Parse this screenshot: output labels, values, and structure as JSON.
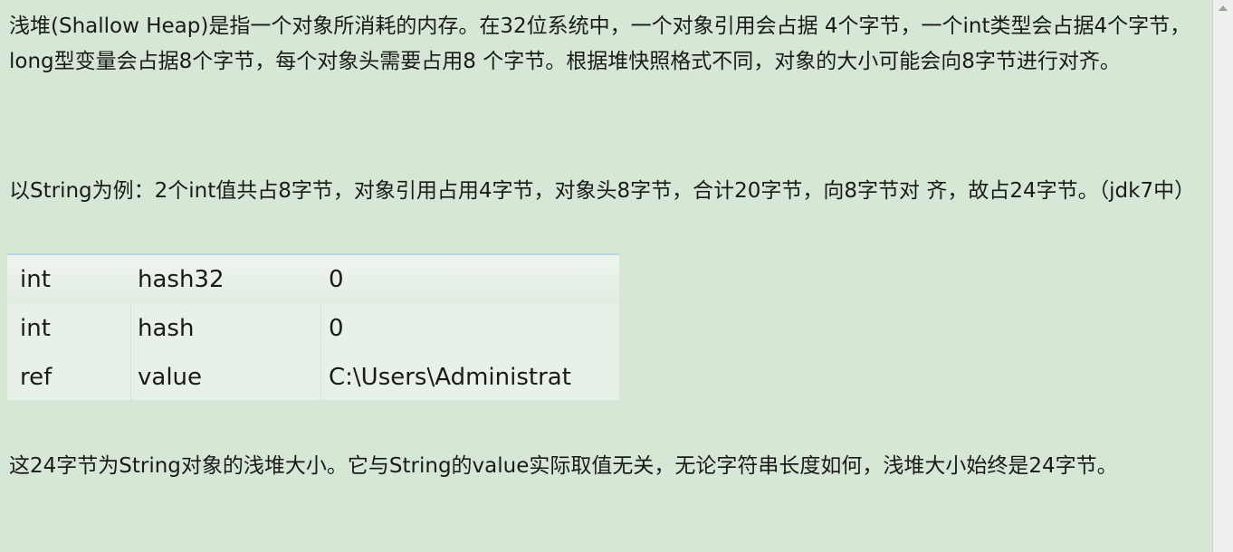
{
  "paragraphs": {
    "p1": "浅堆(Shallow Heap)是指一个对象所消耗的内存。在32位系统中，一个对象引用会占据 4个字节，一个int类型会占据4个字节，long型变量会占据8个字节，每个对象头需要占用8 个字节。根据堆快照格式不同，对象的大小可能会向8字节进行对齐。",
    "p2": "以String为例：2个int值共占8字节，对象引用占用4字节，对象头8字节，合计20字节，向8字节对 齐，故占24字节。（jdk7中）",
    "p3": "这24字节为String对象的浅堆大小。它与String的value实际取值无关，无论字符串长度如何，浅堆大小始终是24字节。"
  },
  "table": {
    "rows": [
      {
        "type": "int",
        "name": "hash32",
        "value": "0"
      },
      {
        "type": "int",
        "name": "hash",
        "value": "0"
      },
      {
        "type": "ref",
        "name": "value",
        "value": "C:\\Users\\Administrat"
      }
    ]
  }
}
